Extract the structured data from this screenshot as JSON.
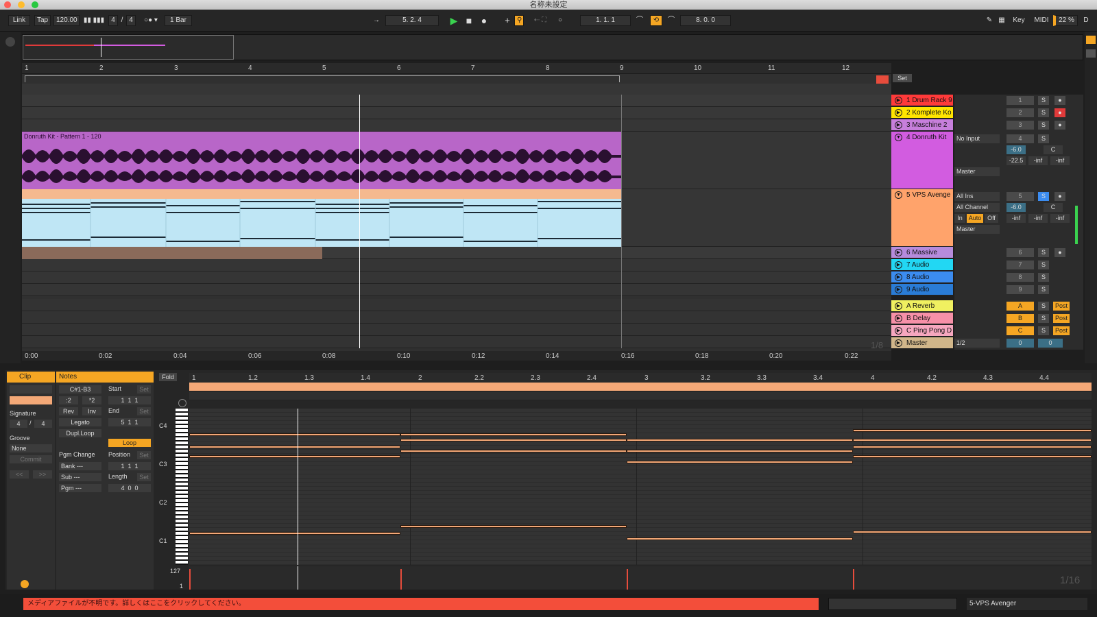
{
  "window": {
    "title": "名称未設定"
  },
  "transport": {
    "link": "Link",
    "tap": "Tap",
    "tempo": "120.00",
    "signature_num": "4",
    "signature_sep": "/",
    "signature_den": "4",
    "quantize": "1 Bar",
    "position": "5.  2.  4",
    "loop_start": "1.  1.  1",
    "loop_length": "8.  0.  0",
    "key": "Key",
    "midi": "MIDI",
    "cpu": "22 %",
    "d": "D"
  },
  "arrangement": {
    "bar_numbers": [
      "1",
      "2",
      "3",
      "4",
      "5",
      "6",
      "7",
      "8",
      "9",
      "10",
      "11",
      "12"
    ],
    "time_labels": [
      "0:00",
      "0:02",
      "0:04",
      "0:06",
      "0:08",
      "0:10",
      "0:12",
      "0:14",
      "0:16",
      "0:18",
      "0:20",
      "0:22"
    ],
    "zoom_label": "1/8",
    "set_label": "Set",
    "clip_name": "Donruth Kit - Pattern 1 - 120"
  },
  "tracks": [
    {
      "name": "1 Drum Rack 9",
      "num": "1",
      "color": "#ff3a3a"
    },
    {
      "name": "2 Komplete Ko",
      "num": "2",
      "color": "#ffe500"
    },
    {
      "name": "3 Maschine 2",
      "num": "3",
      "color": "#c77fdc"
    },
    {
      "name": "4 Donruth Kit",
      "num": "4",
      "color": "#d25ce0"
    },
    {
      "name": "5 VPS Avenge",
      "num": "5",
      "color": "#ffa36b"
    },
    {
      "name": "6 Massive",
      "num": "6",
      "color": "#b68bdc"
    },
    {
      "name": "7 Audio",
      "num": "7",
      "color": "#22d7f3"
    },
    {
      "name": "8 Audio",
      "num": "8",
      "color": "#3b8cf0"
    },
    {
      "name": "9 Audio",
      "num": "9",
      "color": "#2a7cd6"
    },
    {
      "name": "A Reverb",
      "num": "A",
      "color": "#f0f060"
    },
    {
      "name": "B Delay",
      "num": "B",
      "color": "#f790a8"
    },
    {
      "name": "C Ping Pong D",
      "num": "C",
      "color": "#f6a7bf"
    },
    {
      "name": "Master",
      "num": "0",
      "color": "#d1b68a"
    }
  ],
  "mixer": {
    "no_input": "No Input",
    "master": "Master",
    "all_ins": "All Ins",
    "all_channels": "All Channel",
    "vol_db": "-6.0",
    "pan": "C",
    "peak1": "-22.5",
    "inf": "-inf",
    "in": "In",
    "auto": "Auto",
    "off": "Off",
    "solo": "S",
    "post": "Post",
    "half": "1/2"
  },
  "clip_panel": {
    "clip_tab": "Clip",
    "notes_tab": "Notes",
    "signature_label": "Signature",
    "sig_num": "4",
    "sig_den": "4",
    "sig_sep": "/",
    "groove_label": "Groove",
    "groove_value": "None",
    "commit": "Commit",
    "prev": "<<",
    "next": ">>",
    "range": "C#1-B3",
    "div2": ":2",
    "mul2": "*2",
    "rev": "Rev",
    "inv": "Inv",
    "legato": "Legato",
    "dupl": "Dupl.Loop",
    "start": "Start",
    "end": "End",
    "set": "Set",
    "start_vals": [
      "1",
      "1",
      "1"
    ],
    "end_vals": [
      "5",
      "1",
      "1"
    ],
    "loop": "Loop",
    "position": "Position",
    "length": "Length",
    "pos_vals": [
      "1",
      "1",
      "1"
    ],
    "len_vals": [
      "4",
      "0",
      "0"
    ],
    "pgm_change": "Pgm Change",
    "bank": "Bank ---",
    "sub": "Sub ---",
    "pgm": "Pgm ---"
  },
  "piano_roll": {
    "fold": "Fold",
    "beat_labels": [
      "1",
      "1.2",
      "1.3",
      "1.4",
      "2",
      "2.2",
      "2.3",
      "2.4",
      "3",
      "3.2",
      "3.3",
      "3.4",
      "4",
      "4.2",
      "4.3",
      "4.4"
    ],
    "key_labels": [
      "C4",
      "C3",
      "C2",
      "C1"
    ],
    "velocity_max": "127",
    "velocity_min": "1",
    "zoom_label": "1/16"
  },
  "status": {
    "message": "メディアファイルが不明です。詳しくはここをクリックしてください。",
    "device": "5-VPS Avenger"
  }
}
